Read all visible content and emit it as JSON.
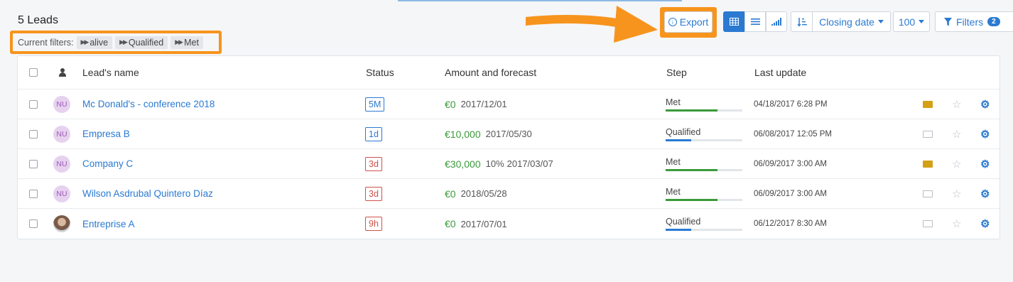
{
  "header": {
    "title": "5 Leads"
  },
  "filters": {
    "label": "Current filters:",
    "chips": [
      "alive",
      "Qualified",
      "Met"
    ]
  },
  "toolbar": {
    "export_label": "Export",
    "sort_label": "Closing date",
    "count_label": "100",
    "filters_label": "Filters",
    "filters_count": "2"
  },
  "table": {
    "headers": {
      "name": "Lead's name",
      "status": "Status",
      "amount": "Amount and forecast",
      "step": "Step",
      "updated": "Last update"
    },
    "rows": [
      {
        "initials": "NU",
        "name": "Mc Donald's - conference 2018",
        "status": "5M",
        "status_color": "blue",
        "amount": "€0",
        "pct": "",
        "date": "2017/12/01",
        "step": "Met",
        "step_progress": 0.68,
        "updated": "04/18/2017 6:28 PM",
        "folder": "open"
      },
      {
        "initials": "NU",
        "name": "Empresa B",
        "status": "1d",
        "status_color": "blue",
        "amount": "€10,000",
        "pct": "",
        "date": "2017/05/30",
        "step": "Qualified",
        "step_progress": 0.33,
        "updated": "06/08/2017 12:05 PM",
        "folder": "closed"
      },
      {
        "initials": "NU",
        "name": "Company C",
        "status": "3d",
        "status_color": "red",
        "amount": "€30,000",
        "pct": "10%",
        "date": "2017/03/07",
        "step": "Met",
        "step_progress": 0.68,
        "updated": "06/09/2017 3:00 AM",
        "folder": "open"
      },
      {
        "initials": "NU",
        "name": "Wilson Asdrubal Quintero Díaz",
        "status": "3d",
        "status_color": "red",
        "amount": "€0",
        "pct": "",
        "date": "2018/05/28",
        "step": "Met",
        "step_progress": 0.68,
        "updated": "06/09/2017 3:00 AM",
        "folder": "closed"
      },
      {
        "initials": "",
        "name": "Entreprise A",
        "status": "9h",
        "status_color": "red",
        "amount": "€0",
        "pct": "",
        "date": "2017/07/01",
        "step": "Qualified",
        "step_progress": 0.33,
        "updated": "06/12/2017 8:30 AM",
        "folder": "closed"
      }
    ]
  },
  "colors": {
    "accent": "#2a7ad2",
    "highlight": "#f7941d",
    "money": "#3a9a3a",
    "alert": "#d0504a",
    "progress_met": "#3a9a3a",
    "progress_qualified": "#2a7ad2"
  }
}
